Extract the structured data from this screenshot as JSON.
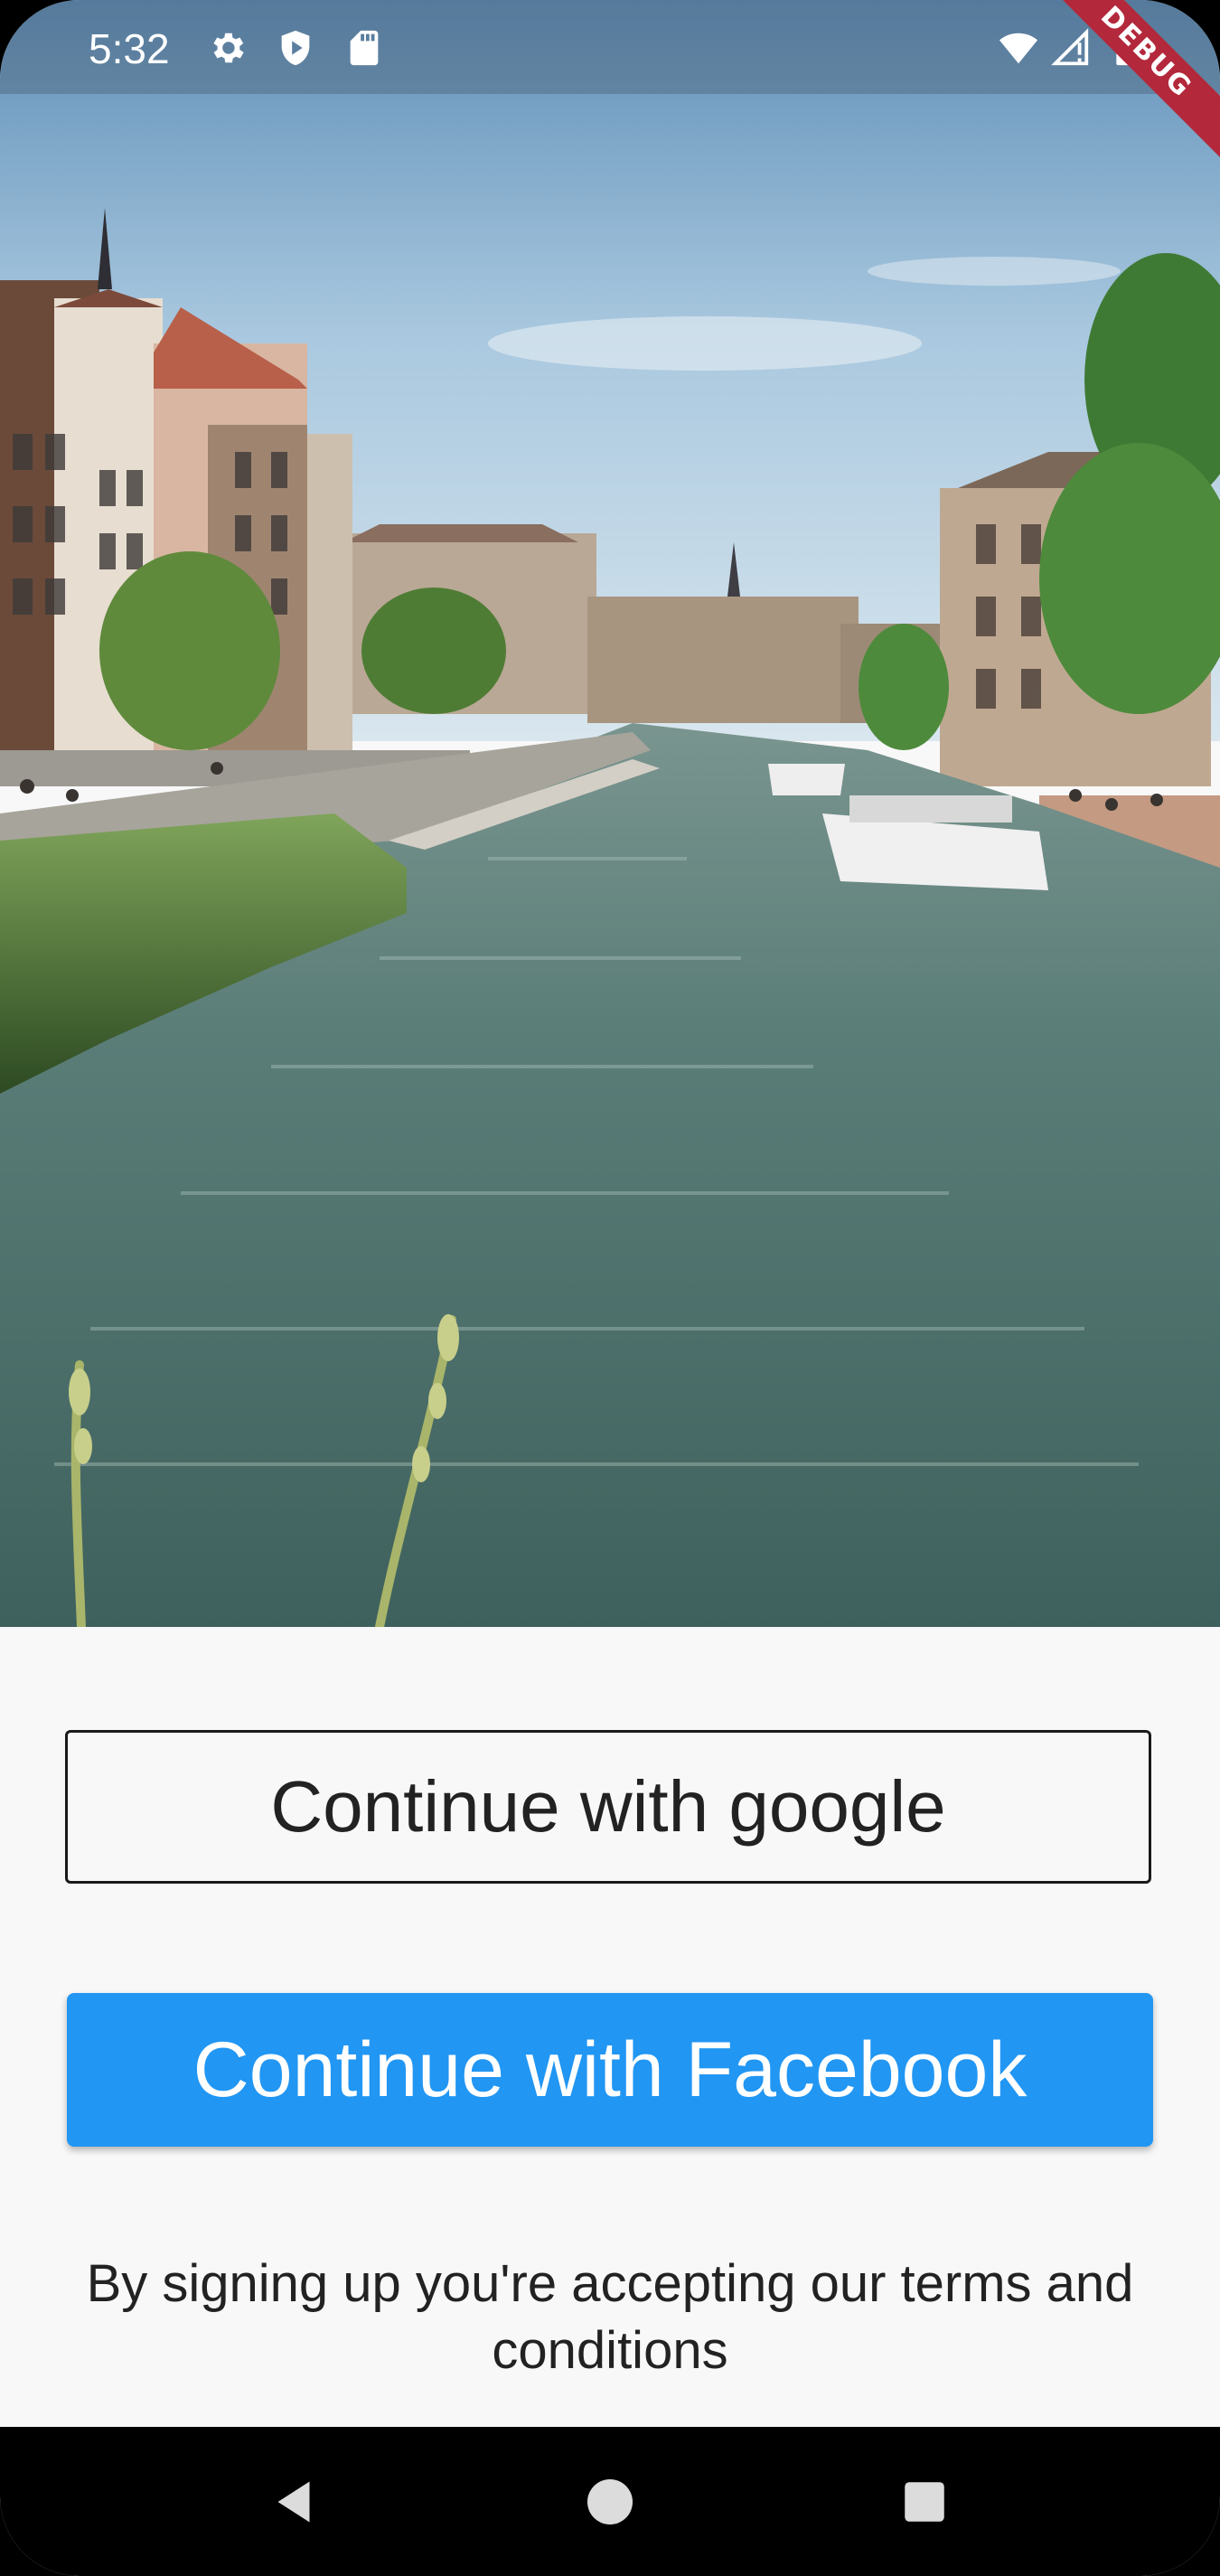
{
  "status_bar": {
    "time": "5:32",
    "icons": [
      "settings-icon",
      "shield-icon",
      "sd-card-icon",
      "wifi-icon",
      "signal-icon",
      "battery-icon"
    ],
    "debug_label": "DEBUG"
  },
  "hero": {
    "image": "canal-city-photo"
  },
  "auth": {
    "google_label": "Continue with google",
    "facebook_label": "Continue with Facebook",
    "terms_text": "By signing up you're accepting our terms and conditions"
  },
  "nav_bar": {
    "icons": [
      "back-icon",
      "home-icon",
      "recents-icon"
    ]
  },
  "colors": {
    "facebook_button": "#2196f3",
    "background": "#f8f8f8",
    "debug_banner": "#b3283b"
  }
}
